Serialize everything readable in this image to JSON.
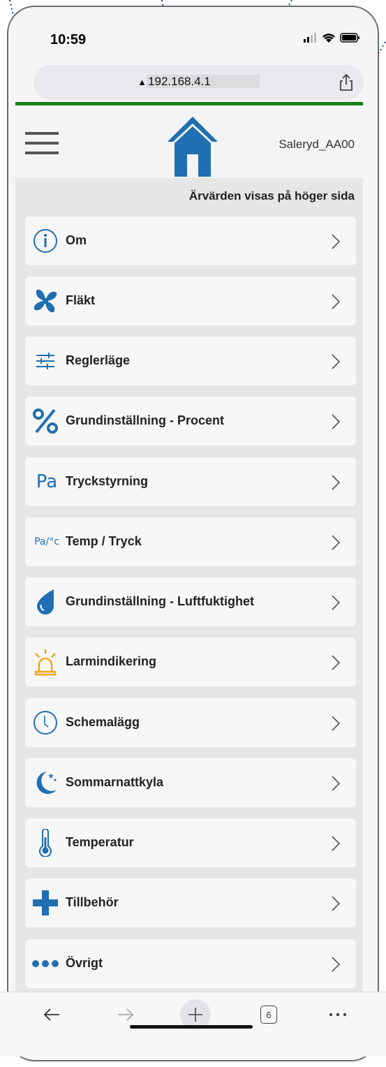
{
  "status_bar": {
    "time": "10:59"
  },
  "browser": {
    "url": "192.168.4.1",
    "tab_count": "6"
  },
  "header": {
    "device_name": "Saleryd_AA00"
  },
  "subtitle": "Ärvärden visas på höger sida",
  "menu_items": [
    {
      "label": "Om",
      "icon": "info-icon"
    },
    {
      "label": "Fläkt",
      "icon": "fan-icon"
    },
    {
      "label": "Reglerläge",
      "icon": "sliders-icon"
    },
    {
      "label": "Grundinställning - Procent",
      "icon": "percent-icon"
    },
    {
      "label": "Tryckstyrning",
      "icon": "pa-icon",
      "icon_text": "Pa"
    },
    {
      "label": "Temp / Tryck",
      "icon": "pa-temp-icon",
      "icon_text": "Pa/°c"
    },
    {
      "label": "Grundinställning - Luftfuktighet",
      "icon": "droplet-icon"
    },
    {
      "label": "Larmindikering",
      "icon": "alarm-icon"
    },
    {
      "label": "Schemalägg",
      "icon": "clock-icon"
    },
    {
      "label": "Sommarnattkyla",
      "icon": "moon-icon"
    },
    {
      "label": "Temperatur",
      "icon": "thermometer-icon"
    },
    {
      "label": "Tillbehör",
      "icon": "plus-icon"
    },
    {
      "label": "Övrigt",
      "icon": "dots-icon"
    }
  ],
  "colors": {
    "accent": "#1f6fb2",
    "green_bar": "#1a7f1a",
    "alarm": "#f2a51a"
  }
}
